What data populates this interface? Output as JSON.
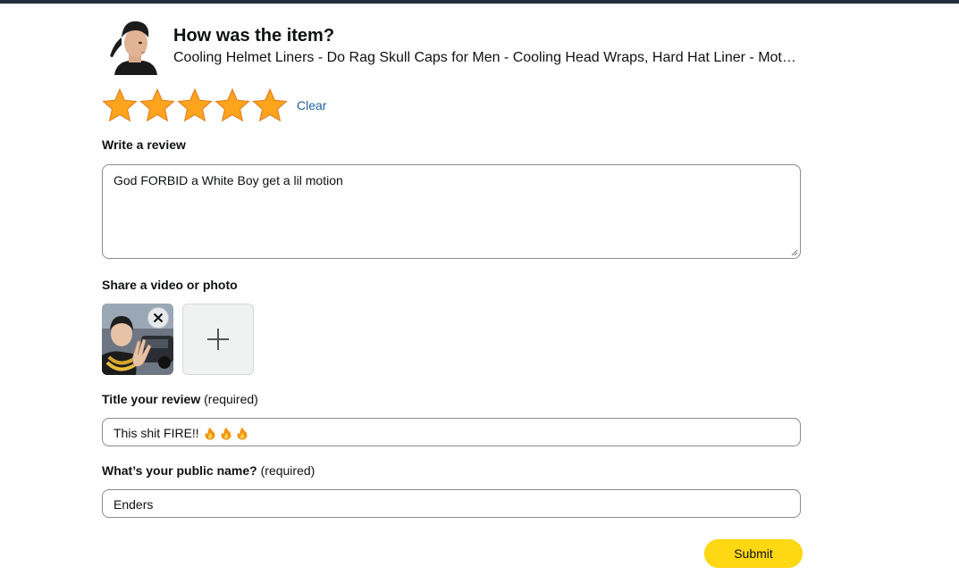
{
  "header": {
    "question": "How was the item?",
    "product_name": "Cooling Helmet Liners - Do Rag Skull Caps for Men - Cooling Head Wraps, Hard Hat Liner - Motorcycle Helmet Liner",
    "product_image_icon": "man-wearing-skull-cap-photo"
  },
  "rating": {
    "value": 5,
    "max": 5,
    "star_color": "#ffa41c",
    "clear_label": "Clear"
  },
  "review": {
    "label": "Write a review",
    "text": "God FORBID a White Boy get a lil motion"
  },
  "media": {
    "label": "Share a video or photo",
    "uploaded_icon": "uploaded-photo-thumbnail",
    "remove_icon": "close-icon",
    "add_icon": "plus-icon"
  },
  "title_field": {
    "label": "Title your review",
    "required_note": "(required)",
    "value": "This shit FIRE!!",
    "emoji_icons": [
      "fire-emoji",
      "fire-emoji",
      "fire-emoji"
    ]
  },
  "public_name": {
    "label": "What’s your public name?",
    "required_note": "(required)",
    "value": "Enders"
  },
  "submit_label": "Submit",
  "colors": {
    "link": "#2162a1",
    "button": "#ffd814",
    "topbar": "#232f3e"
  }
}
